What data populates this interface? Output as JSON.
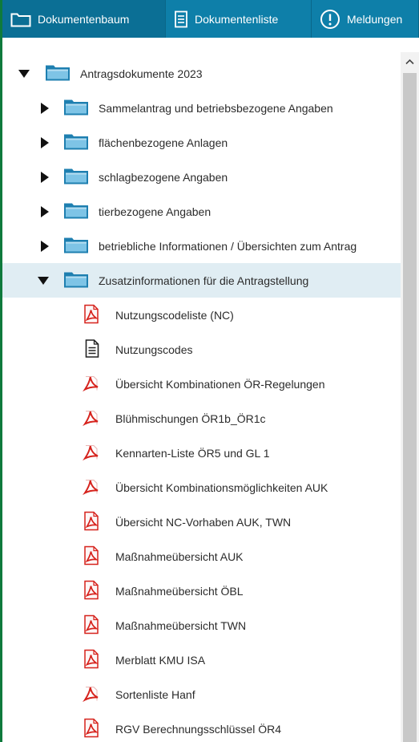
{
  "tabs": [
    {
      "label": "Dokumentenbaum",
      "icon": "folder-icon",
      "active": true
    },
    {
      "label": "Dokumentenliste",
      "icon": "list-icon",
      "active": false
    },
    {
      "label": "Meldungen",
      "icon": "alert-icon",
      "active": false
    }
  ],
  "tree": {
    "root": {
      "label": "Antragsdokumente 2023",
      "expanded": true
    },
    "folders": [
      {
        "label": "Sammelantrag und betriebsbezogene Angaben",
        "expanded": false
      },
      {
        "label": "flächenbezogene Anlagen",
        "expanded": false
      },
      {
        "label": "schlagbezogene Angaben",
        "expanded": false
      },
      {
        "label": "tierbezogene Angaben",
        "expanded": false
      },
      {
        "label": "betriebliche Informationen / Übersichten zum Antrag",
        "expanded": false
      },
      {
        "label": "Zusatzinformationen für die Antragstellung",
        "expanded": true,
        "selected": true
      }
    ],
    "documents": [
      {
        "label": "Nutzungscodeliste (NC)",
        "type": "pdf-icon"
      },
      {
        "label": "Nutzungscodes",
        "type": "text-document-icon"
      },
      {
        "label": "Übersicht Kombinationen ÖR-Regelungen",
        "type": "pdf-icon"
      },
      {
        "label": "Blühmischungen ÖR1b_ÖR1c",
        "type": "pdf-icon"
      },
      {
        "label": "Kennarten-Liste ÖR5 und GL 1",
        "type": "pdf-icon"
      },
      {
        "label": "Übersicht Kombinationsmöglichkeiten AUK",
        "type": "pdf-icon"
      },
      {
        "label": "Übersicht NC-Vorhaben AUK, TWN",
        "type": "pdf-icon"
      },
      {
        "label": "Maßnahmeübersicht AUK",
        "type": "pdf-icon"
      },
      {
        "label": "Maßnahmeübersicht ÖBL",
        "type": "pdf-icon"
      },
      {
        "label": "Maßnahmeübersicht TWN",
        "type": "pdf-icon"
      },
      {
        "label": "Merblatt KMU ISA",
        "type": "pdf-icon"
      },
      {
        "label": "Sortenliste Hanf",
        "type": "pdf-icon"
      },
      {
        "label": "RGV Berechnungsschlüssel ÖR4",
        "type": "pdf-icon"
      }
    ]
  },
  "colors": {
    "tab_bar": "#0e7fa9",
    "tab_active": "#0b6f95",
    "frame_border": "#0f7a3c",
    "selected_row": "#e0edf3",
    "folder": "#1e7fb0",
    "pdf_red": "#d6221c"
  }
}
